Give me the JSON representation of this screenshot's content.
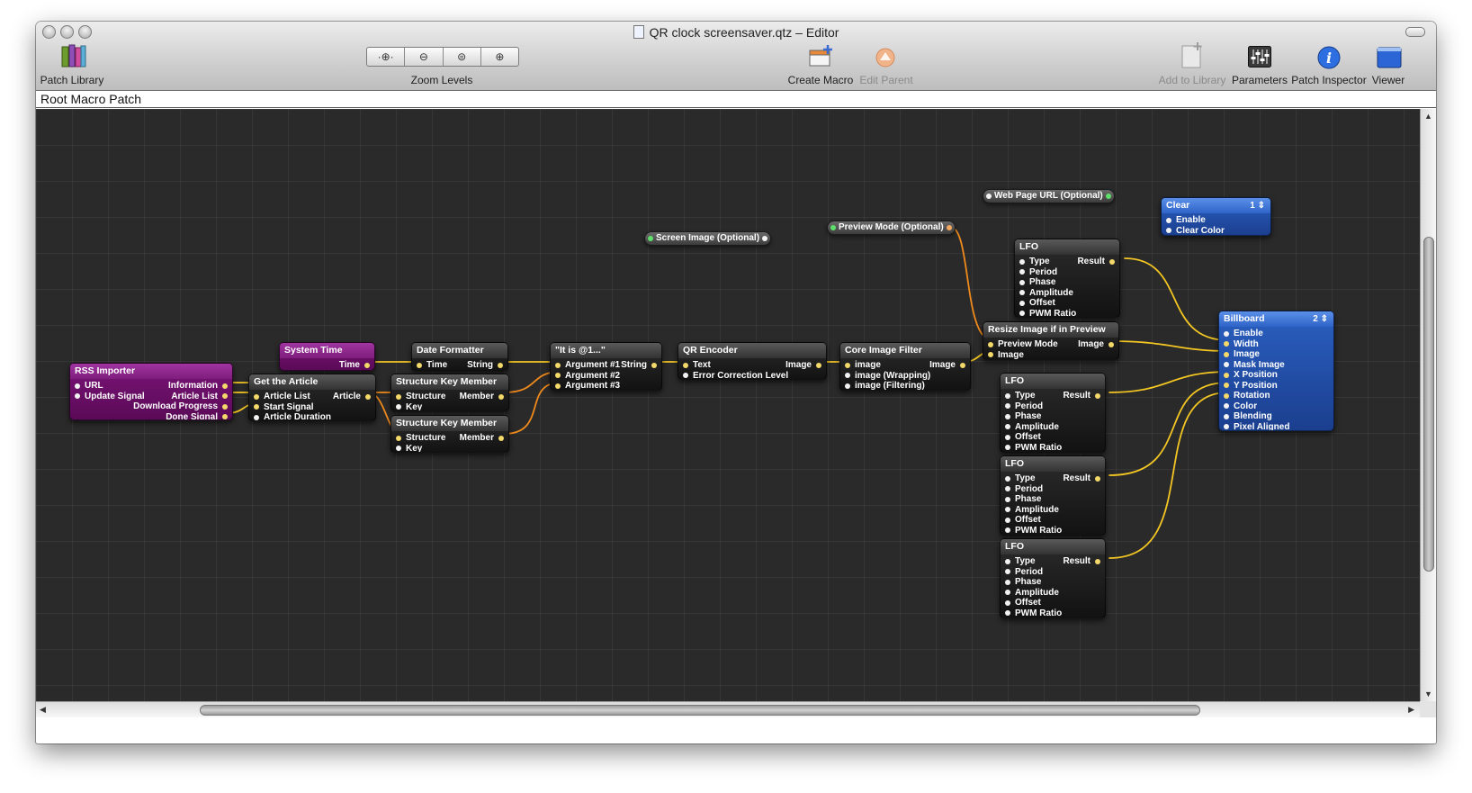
{
  "window": {
    "title": "QR clock screensaver.qtz – Editor"
  },
  "toolbar": {
    "patch_library": "Patch Library",
    "zoom_levels": "Zoom Levels",
    "create_macro": "Create Macro",
    "edit_parent": "Edit Parent",
    "add_to_library": "Add to Library",
    "parameters": "Parameters",
    "patch_inspector": "Patch Inspector",
    "viewer": "Viewer"
  },
  "pathbar": {
    "label": "Root Macro Patch"
  },
  "published": {
    "screen_image": "Screen Image (Optional)",
    "preview_mode": "Preview Mode (Optional)",
    "web_page_url": "Web Page URL (Optional)"
  },
  "patches": {
    "rss": {
      "title": "RSS Importer",
      "inputs": [
        "URL",
        "Update Signal"
      ],
      "outputs": [
        "Information",
        "Article List",
        "Download Progress",
        "Done Signal"
      ]
    },
    "system_time": {
      "title": "System Time",
      "outputs": [
        "Time"
      ]
    },
    "get_article": {
      "title": "Get the Article",
      "inputs": [
        "Article List",
        "Start Signal",
        "Article Duration"
      ],
      "outputs": [
        "Article"
      ]
    },
    "date_formatter": {
      "title": "Date Formatter",
      "inputs": [
        "Time"
      ],
      "outputs": [
        "String"
      ]
    },
    "skm1": {
      "title": "Structure Key Member",
      "inputs": [
        "Structure",
        "Key"
      ],
      "outputs": [
        "Member"
      ]
    },
    "skm2": {
      "title": "Structure Key Member",
      "inputs": [
        "Structure",
        "Key"
      ],
      "outputs": [
        "Member"
      ]
    },
    "it_is": {
      "title": "\"It is @1...\"",
      "inputs": [
        "Argument #1",
        "Argument #2",
        "Argument #3"
      ],
      "outputs": [
        "String"
      ]
    },
    "qr_encoder": {
      "title": "QR Encoder",
      "inputs": [
        "Text",
        "Error Correction Level"
      ],
      "outputs": [
        "Image"
      ]
    },
    "ci_filter": {
      "title": "Core Image Filter",
      "inputs": [
        "image",
        "image (Wrapping)",
        "image (Filtering)"
      ],
      "outputs": [
        "Image"
      ]
    },
    "resize": {
      "title": "Resize Image if in Preview",
      "inputs": [
        "Preview Mode",
        "Image"
      ],
      "outputs": [
        "Image"
      ]
    },
    "lfo_top": {
      "title": "LFO",
      "inputs": [
        "Type",
        "Period",
        "Phase",
        "Amplitude",
        "Offset",
        "PWM Ratio"
      ],
      "outputs": [
        "Result"
      ]
    },
    "lfo_a": {
      "title": "LFO",
      "inputs": [
        "Type",
        "Period",
        "Phase",
        "Amplitude",
        "Offset",
        "PWM Ratio"
      ],
      "outputs": [
        "Result"
      ]
    },
    "lfo_b": {
      "title": "LFO",
      "inputs": [
        "Type",
        "Period",
        "Phase",
        "Amplitude",
        "Offset",
        "PWM Ratio"
      ],
      "outputs": [
        "Result"
      ]
    },
    "lfo_c": {
      "title": "LFO",
      "inputs": [
        "Type",
        "Period",
        "Phase",
        "Amplitude",
        "Offset",
        "PWM Ratio"
      ],
      "outputs": [
        "Result"
      ]
    },
    "clear": {
      "title": "Clear",
      "layer": "1",
      "inputs": [
        "Enable",
        "Clear Color"
      ]
    },
    "billboard": {
      "title": "Billboard",
      "layer": "2",
      "inputs": [
        "Enable",
        "Width",
        "Image",
        "Mask Image",
        "X Position",
        "Y Position",
        "Rotation",
        "Color",
        "Blending",
        "Pixel Aligned"
      ]
    }
  },
  "colors": {
    "canvas": "#2a2a2a",
    "wire_yellow": "#f3c623",
    "wire_orange": "#f08a1c",
    "consumer_blue": "#2a5fc0",
    "provider_purple": "#7a1477"
  }
}
